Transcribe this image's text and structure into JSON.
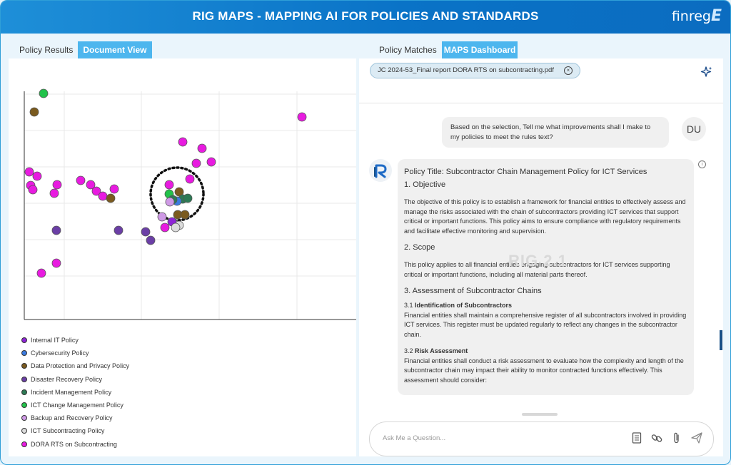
{
  "header": {
    "title": "RIG MAPS - MAPPING AI FOR POLICIES AND STANDARDS",
    "brand": "finreg",
    "brand_mark": "E"
  },
  "left_tabs": [
    "Policy Results",
    "Document View"
  ],
  "right_tabs": [
    "Policy Matches",
    "MAPS Dashboard"
  ],
  "colors": {
    "header": "#0b6cc0",
    "active_tab": "#4db6ee"
  },
  "plot": {
    "points": [
      {
        "series": "ICT Change Management Policy",
        "x": 60,
        "y": 130
      },
      {
        "series": "Data Protection and Privacy Policy",
        "x": 47,
        "y": 156
      },
      {
        "series": "DORA RTS on Subcontracting",
        "x": 422,
        "y": 163
      },
      {
        "series": "DORA RTS on Subcontracting",
        "x": 255,
        "y": 198
      },
      {
        "series": "DORA RTS on Subcontracting",
        "x": 282,
        "y": 207
      },
      {
        "series": "DORA RTS on Subcontracting",
        "x": 295,
        "y": 226
      },
      {
        "series": "DORA RTS on Subcontracting",
        "x": 274,
        "y": 228
      },
      {
        "series": "DORA RTS on Subcontracting",
        "x": 40,
        "y": 240
      },
      {
        "series": "DORA RTS on Subcontracting",
        "x": 51,
        "y": 246
      },
      {
        "series": "DORA RTS on Subcontracting",
        "x": 265,
        "y": 250
      },
      {
        "series": "DORA RTS on Subcontracting",
        "x": 112,
        "y": 252
      },
      {
        "series": "DORA RTS on Subcontracting",
        "x": 126,
        "y": 258
      },
      {
        "series": "DORA RTS on Subcontracting",
        "x": 236,
        "y": 258
      },
      {
        "series": "DORA RTS on Subcontracting",
        "x": 42,
        "y": 259
      },
      {
        "series": "DORA RTS on Subcontracting",
        "x": 79,
        "y": 258
      },
      {
        "series": "DORA RTS on Subcontracting",
        "x": 134,
        "y": 267
      },
      {
        "series": "DORA RTS on Subcontracting",
        "x": 45,
        "y": 265
      },
      {
        "series": "DORA RTS on Subcontracting",
        "x": 159,
        "y": 264
      },
      {
        "series": "DORA RTS on Subcontracting",
        "x": 75,
        "y": 270
      },
      {
        "series": "DORA RTS on Subcontracting",
        "x": 143,
        "y": 274
      },
      {
        "series": "Data Protection and Privacy Policy",
        "x": 154,
        "y": 277
      },
      {
        "series": "Data Protection and Privacy Policy",
        "x": 250,
        "y": 268
      },
      {
        "series": "ICT Change Management Policy",
        "x": 236,
        "y": 271
      },
      {
        "series": "Incident Management Policy",
        "x": 255,
        "y": 278
      },
      {
        "series": "Incident Management Policy",
        "x": 262,
        "y": 277
      },
      {
        "series": "Cybersecurity Policy",
        "x": 247,
        "y": 281
      },
      {
        "series": "Incident Management Policy",
        "x": 241,
        "y": 279
      },
      {
        "series": "Backup and Recovery Policy",
        "x": 237,
        "y": 282
      },
      {
        "series": "Data Protection and Privacy Policy",
        "x": 248,
        "y": 300
      },
      {
        "series": "Data Protection and Privacy Policy",
        "x": 258,
        "y": 300
      },
      {
        "series": "Backup and Recovery Policy",
        "x": 226,
        "y": 303
      },
      {
        "series": "Disaster Recovery Policy",
        "x": 78,
        "y": 322
      },
      {
        "series": "Disaster Recovery Policy",
        "x": 165,
        "y": 322
      },
      {
        "series": "Disaster Recovery Policy",
        "x": 203,
        "y": 324
      },
      {
        "series": "DORA RTS on Subcontracting",
        "x": 230,
        "y": 318
      },
      {
        "series": "Internal IT Policy",
        "x": 240,
        "y": 310
      },
      {
        "series": "ICT Subcontracting Policy",
        "x": 250,
        "y": 315
      },
      {
        "series": "ICT Subcontracting Policy",
        "x": 245,
        "y": 318
      },
      {
        "series": "Disaster Recovery Policy",
        "x": 210,
        "y": 336
      },
      {
        "series": "DORA RTS on Subcontracting",
        "x": 78,
        "y": 368
      },
      {
        "series": "DORA RTS on Subcontracting",
        "x": 57,
        "y": 382
      }
    ]
  },
  "legend": [
    {
      "label": "Internal IT Policy",
      "color": "#8e24d6"
    },
    {
      "label": "Cybersecurity Policy",
      "color": "#3b7be0"
    },
    {
      "label": "Data Protection and Privacy Policy",
      "color": "#7a5a1e"
    },
    {
      "label": "Disaster Recovery Policy",
      "color": "#6b3fa6"
    },
    {
      "label": "Incident Management Policy",
      "color": "#2d7a55"
    },
    {
      "label": "ICT Change Management Policy",
      "color": "#22c24a"
    },
    {
      "label": "Backup and Recovery Policy",
      "color": "#cf9ae6"
    },
    {
      "label": "ICT Subcontracting Policy",
      "color": "#dcdcdc"
    },
    {
      "label": "DORA RTS on Subcontracting",
      "color": "#e81be0"
    }
  ],
  "chat": {
    "document_chip": "JC 2024-53_Final report DORA RTS on subcontracting.pdf",
    "user_message": "Based on the selection, Tell me what improvements shall I make to my policies to meet the rules text?",
    "user_avatar": "DU",
    "watermark": "RIG 2.1",
    "answer": {
      "title": "Policy Title: Subcontractor Chain Management Policy for ICT Services",
      "h1": "1. Objective",
      "p1": "The objective of this policy is to establish a framework for financial entities to effectively assess and manage the risks associated with the chain of subcontractors providing ICT services that support critical or important functions. This policy aims to ensure compliance with regulatory requirements and facilitate effective monitoring and supervision.",
      "h2": "2. Scope",
      "p2": "This policy applies to all financial entities engaging subcontractors for ICT services supporting critical or important functions, including all material parts thereof.",
      "h3": "3. Assessment of Subcontractor Chains",
      "s31_num": "3.1",
      "s31_title": "Identification of Subcontractors",
      "s31_text": "Financial entities shall maintain a comprehensive register of all subcontractors involved in providing ICT services. This register must be updated regularly to reflect any changes in the subcontractor chain.",
      "s32_num": "3.2",
      "s32_title": "Risk Assessment",
      "s32_text": "Financial entities shall conduct a risk assessment to evaluate how the complexity and length of the subcontractor chain may impact their ability to monitor contracted functions effectively. This assessment should consider:"
    },
    "input_placeholder": "Ask Me a Question..."
  }
}
